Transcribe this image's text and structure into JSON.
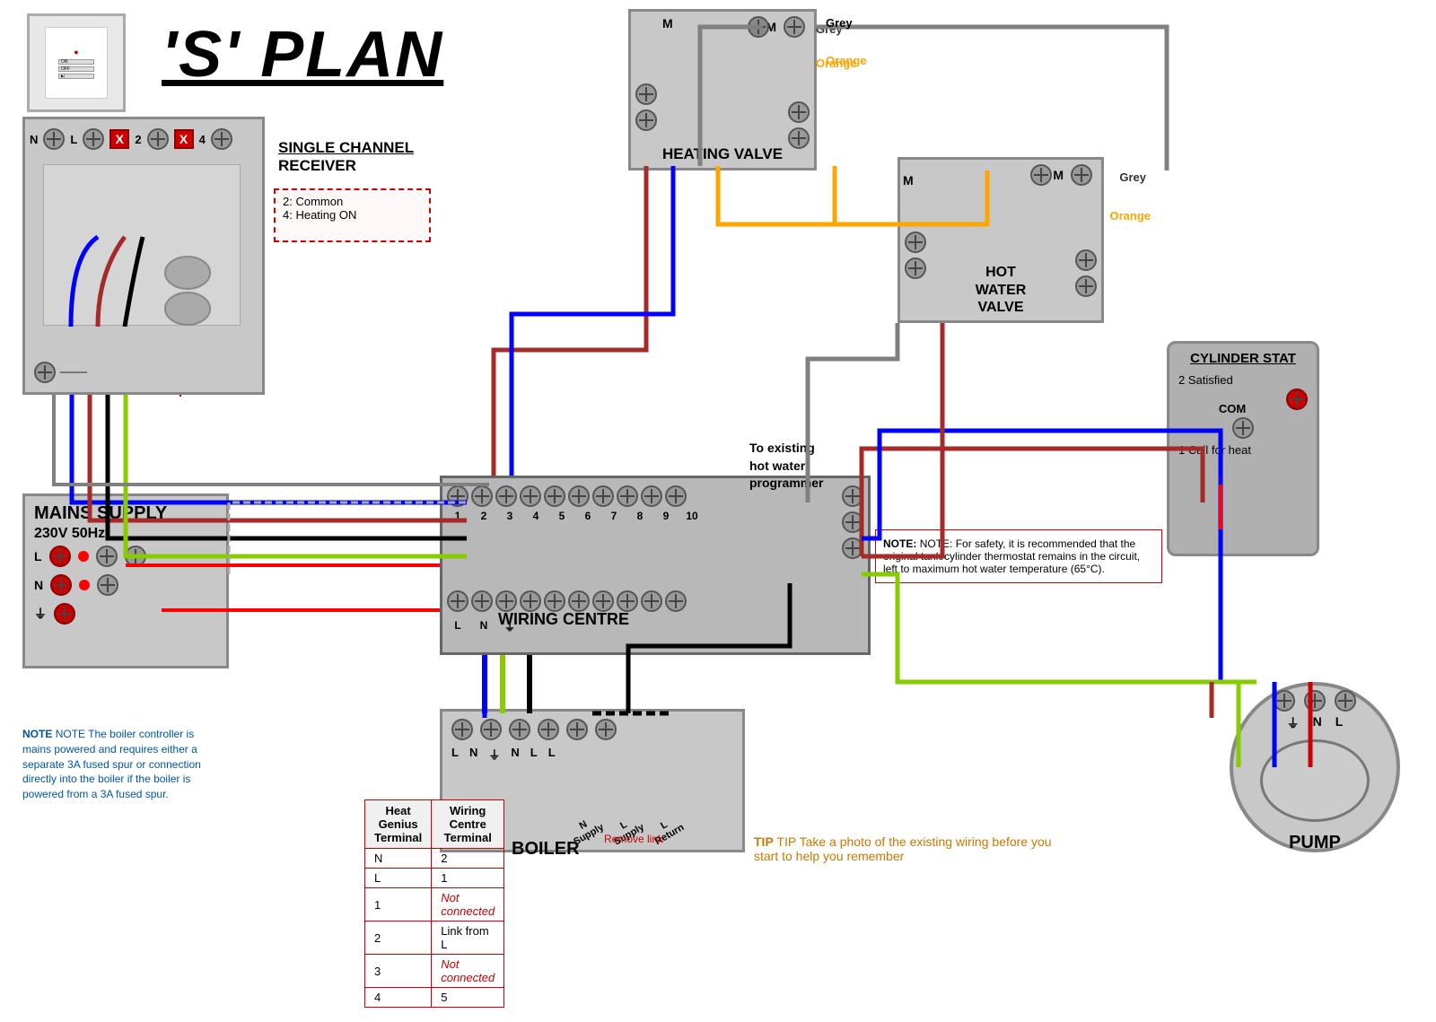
{
  "title": "'S' PLAN",
  "thermostat": {
    "buttons": [
      "ON",
      "OFF",
      ""
    ]
  },
  "receiver": {
    "title": "SINGLE CHANNEL",
    "subtitle": "RECEIVER",
    "terminal_2": "2: Common",
    "terminal_4": "4: Heating ON",
    "terminals": [
      "N",
      "L",
      "X",
      "2",
      "X",
      "4"
    ]
  },
  "heating_valve": {
    "label": "HEATING VALVE",
    "wire_grey": "Grey",
    "wire_orange": "Orange",
    "motor": "M"
  },
  "hot_water_valve": {
    "label": "HOT WATER VALVE",
    "wire_grey": "Grey",
    "wire_orange": "Orange",
    "motor": "M"
  },
  "wiring_centre": {
    "label": "WIRING CENTRE",
    "terminals": [
      "1",
      "2",
      "3",
      "4",
      "5",
      "6",
      "7",
      "8",
      "9",
      "10"
    ],
    "bottom_labels": [
      "L",
      "N",
      "⏚",
      "",
      "",
      "",
      "",
      "",
      "",
      ""
    ]
  },
  "boiler": {
    "label": "BOILER",
    "terminals": [
      "L",
      "N",
      "⏚",
      "N",
      "L",
      "L"
    ],
    "labels": [
      "",
      "",
      "",
      "N Supply",
      "L Supply",
      "L Return"
    ],
    "remove_link": "Remove link"
  },
  "mains": {
    "label": "MAINS SUPPLY",
    "voltage": "230V 50Hz",
    "L": "L",
    "N": "N",
    "earth": "⏚"
  },
  "cylinder_stat": {
    "label": "CYLINDER STAT",
    "satisfied": "2 Satisfied",
    "call_for_heat": "1 Call for heat",
    "com": "COM"
  },
  "pump": {
    "label": "PUMP",
    "terminals": [
      "⏚",
      "N",
      "L"
    ]
  },
  "table": {
    "headers": [
      "Heat Genius Terminal",
      "Wiring Centre Terminal"
    ],
    "rows": [
      [
        "N",
        "2"
      ],
      [
        "L",
        "1"
      ],
      [
        "1",
        "Not connected"
      ],
      [
        "2",
        "Link from L"
      ],
      [
        "3",
        "Not connected"
      ],
      [
        "4",
        "5"
      ]
    ]
  },
  "to_programmer": "To existing\nhot water\nprogrammer",
  "note_bottom": "NOTE The boiler controller is mains powered and requires either a separate 3A fused spur or connection directly into the boiler if the boiler is powered from a 3A fused spur.",
  "note_safety": "NOTE: For safety, it is recommended that the original tank/cylinder thermostat remains in the circuit, left to maximum hot water temperature (65°C).",
  "tip": "TIP Take a photo of the existing wiring before you start to help you remember"
}
